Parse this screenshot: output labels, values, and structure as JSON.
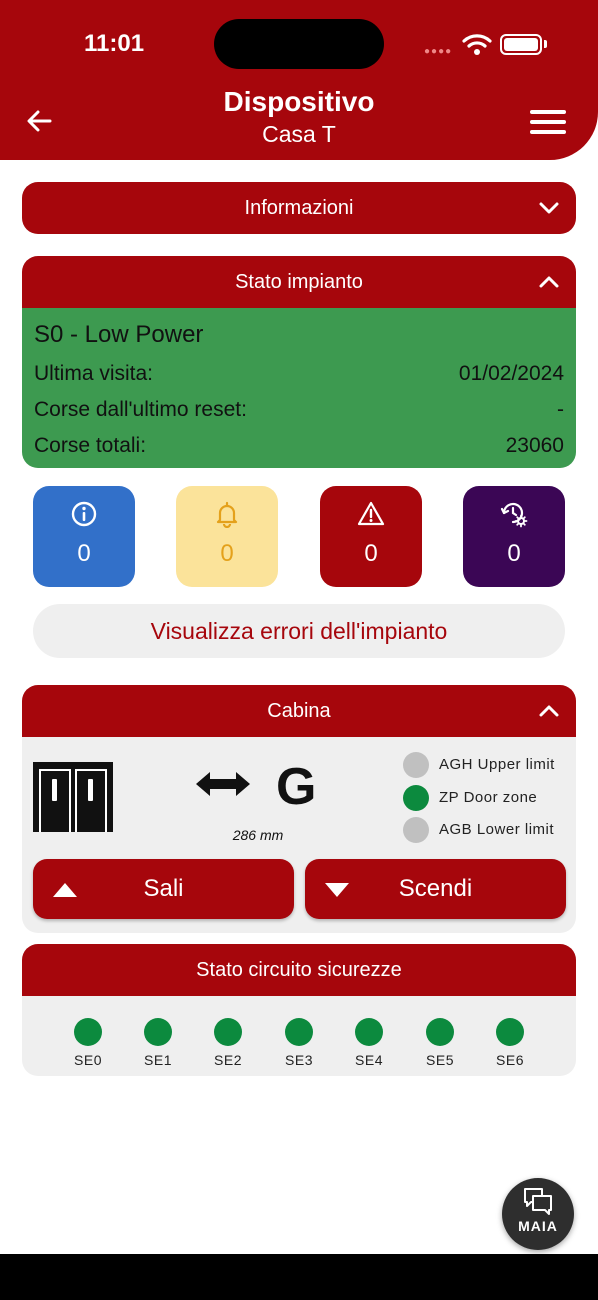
{
  "status_bar": {
    "time": "11:01"
  },
  "header": {
    "title": "Dispositivo",
    "subtitle": "Casa T"
  },
  "informazioni": {
    "label": "Informazioni"
  },
  "stato_impianto": {
    "label": "Stato impianto",
    "state": "S0 - Low Power",
    "rows": [
      {
        "label": "Ultima visita:",
        "value": "01/02/2024"
      },
      {
        "label": "Corse dall'ultimo reset:",
        "value": "-"
      },
      {
        "label": "Corse totali:",
        "value": "23060"
      }
    ]
  },
  "counters": [
    {
      "icon": "info-icon",
      "value": "0",
      "bg": "#3270c9",
      "fg": "#ffffff"
    },
    {
      "icon": "bell-icon",
      "value": "0",
      "bg": "#fbe39a",
      "fg": "#e4a11b"
    },
    {
      "icon": "warning-icon",
      "value": "0",
      "bg": "#a6060c",
      "fg": "#ffffff"
    },
    {
      "icon": "history-settings-icon",
      "value": "0",
      "bg": "#3b0655",
      "fg": "#ffffff"
    }
  ],
  "errors_button": {
    "label": "Visualizza errori dell'impianto"
  },
  "cabina": {
    "label": "Cabina",
    "floor": "G",
    "distance": "286 mm",
    "indicators": [
      {
        "label": "AGH Upper limit",
        "active": false
      },
      {
        "label": "ZP Door zone",
        "active": true
      },
      {
        "label": "AGB Lower limit",
        "active": false
      }
    ],
    "up_label": "Sali",
    "down_label": "Scendi"
  },
  "circuito": {
    "label": "Stato circuito sicurezze",
    "items": [
      "SE0",
      "SE1",
      "SE2",
      "SE3",
      "SE4",
      "SE5",
      "SE6"
    ]
  },
  "assistant": {
    "label": "MAIA"
  },
  "colors": {
    "primary": "#a6060c",
    "ok": "#3d9a50",
    "led_on": "#0c8a3e",
    "led_off": "#c0c0c0"
  }
}
